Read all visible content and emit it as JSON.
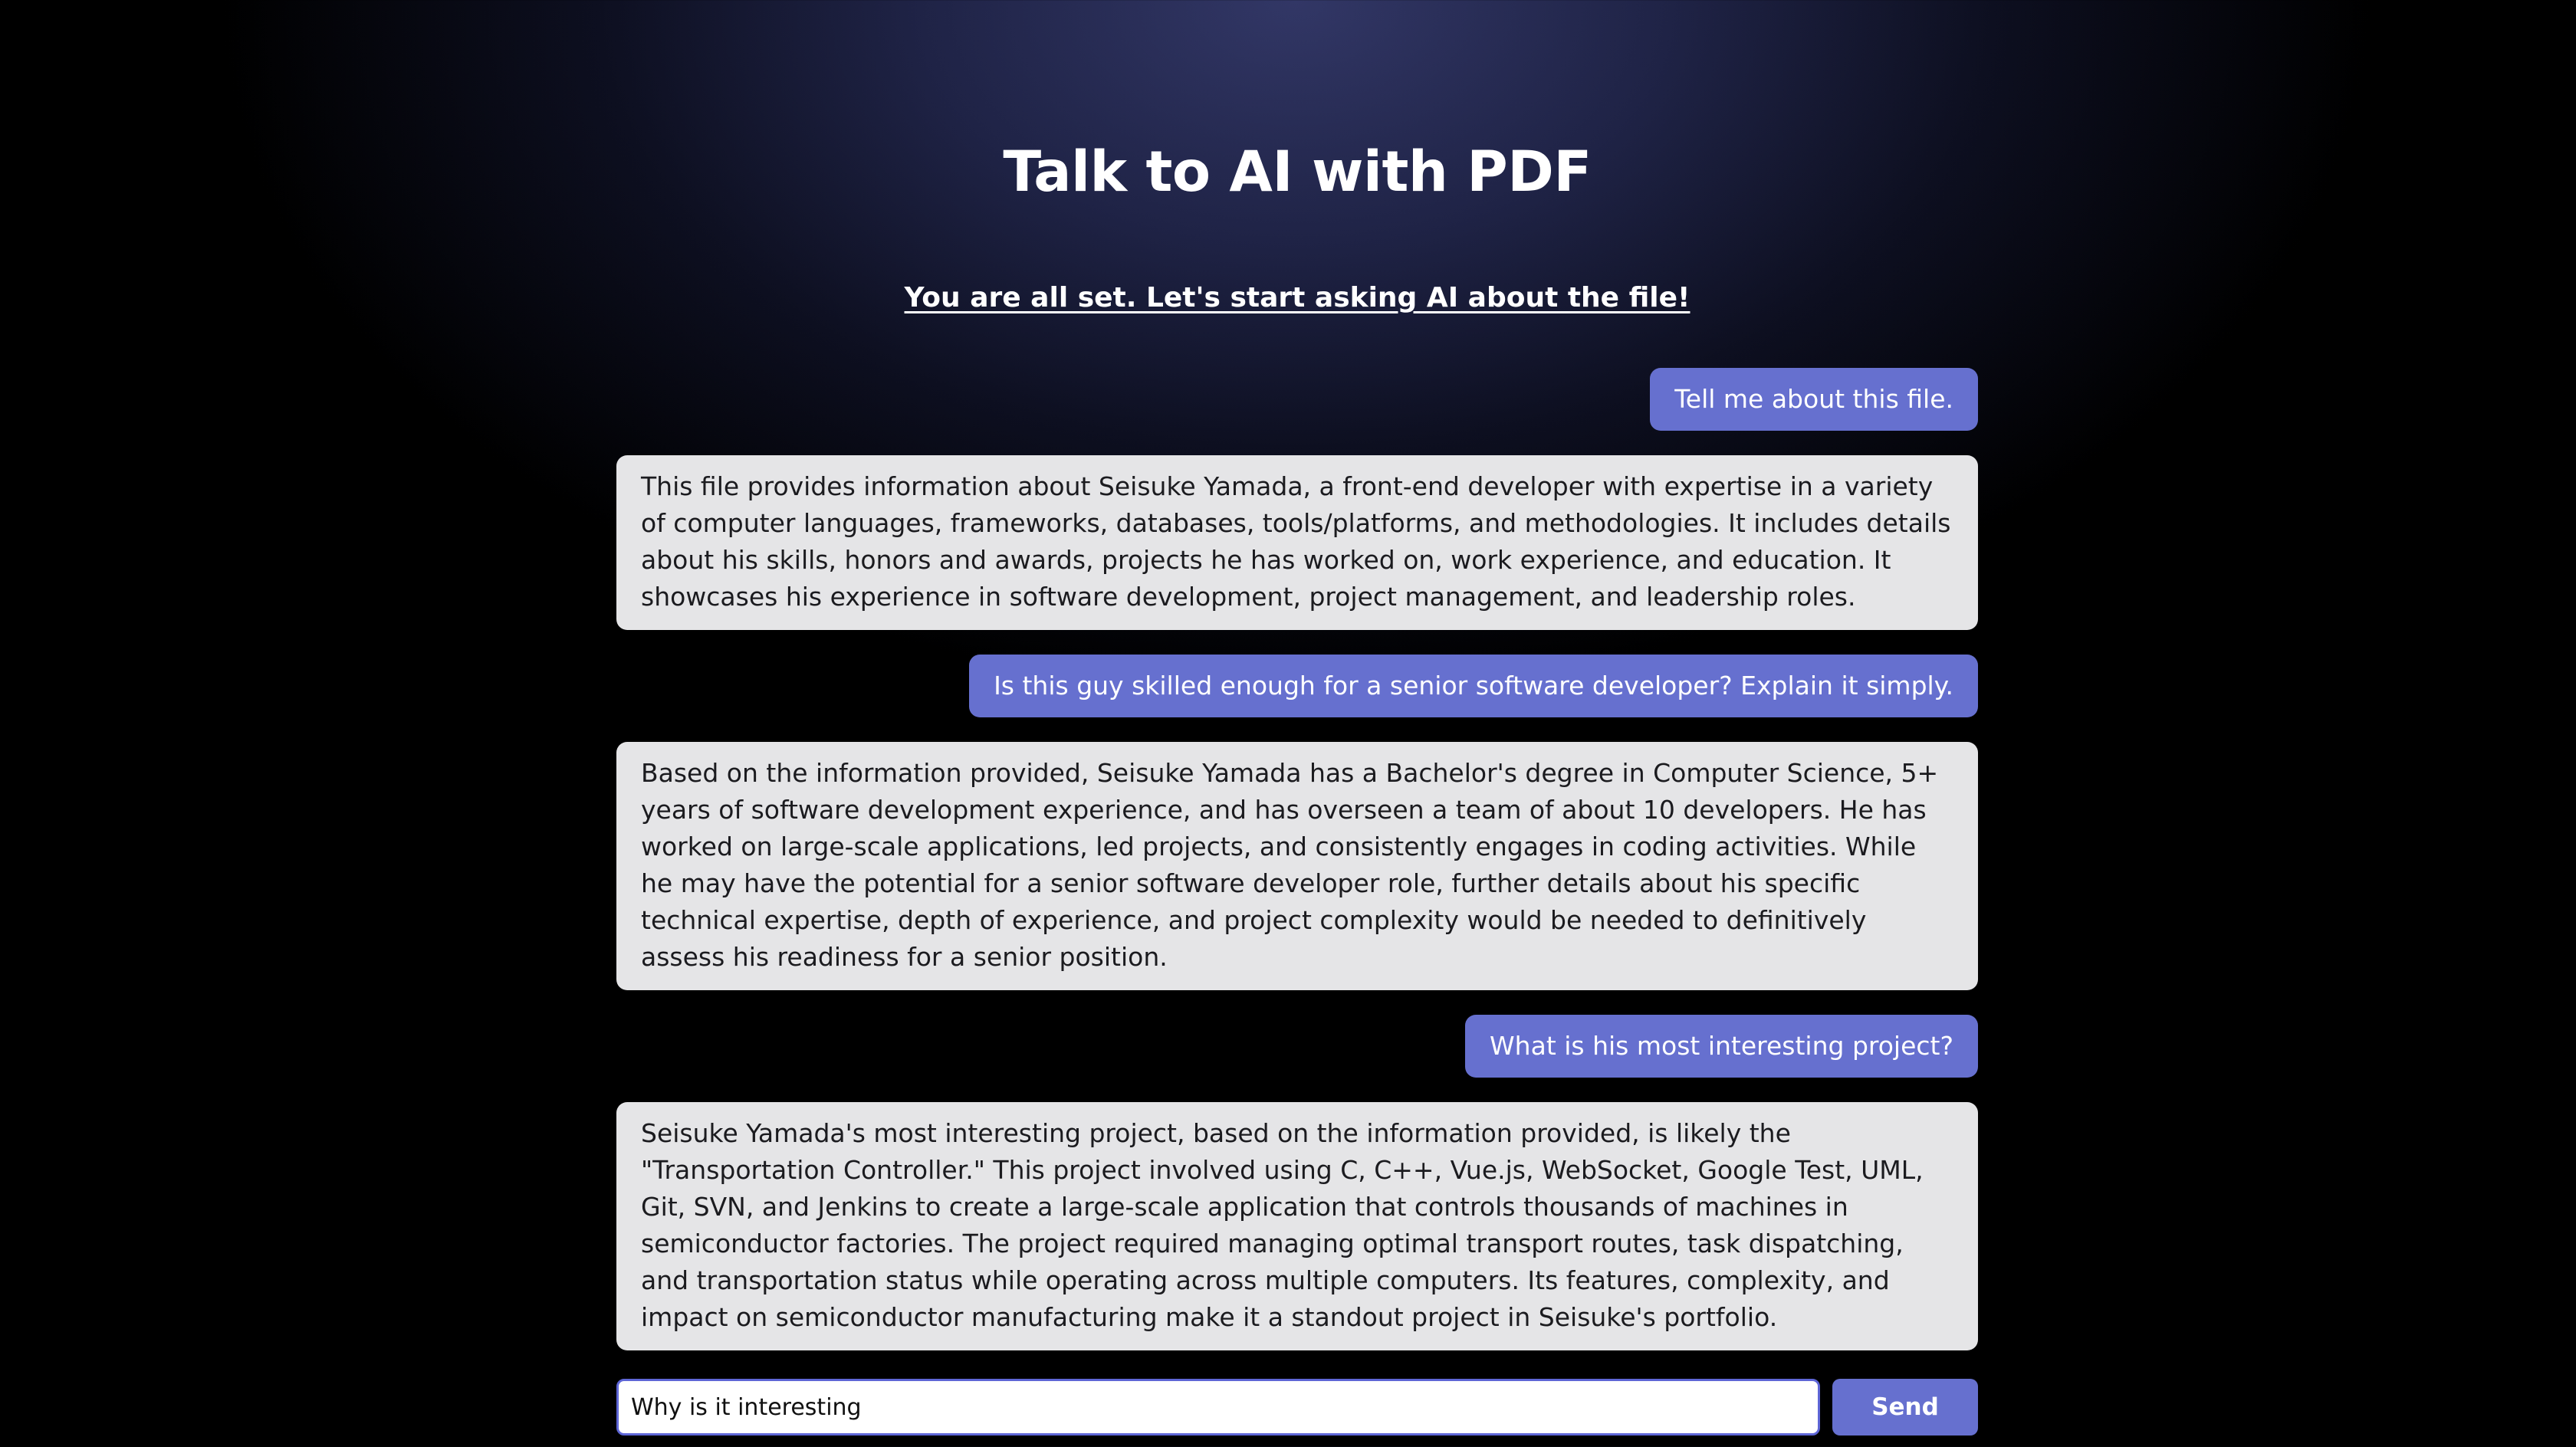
{
  "header": {
    "title": "Talk to AI with PDF",
    "status": "You are all set. Let's start asking AI about the file!"
  },
  "chat": {
    "messages": [
      {
        "role": "user",
        "text": "Tell me about this file."
      },
      {
        "role": "ai",
        "text": "This file provides information about Seisuke Yamada, a front-end developer with expertise in a variety of computer languages, frameworks, databases, tools/platforms, and methodologies. It includes details about his skills, honors and awards, projects he has worked on, work experience, and education. It showcases his experience in software development, project management, and leadership roles."
      },
      {
        "role": "user",
        "text": "Is this guy skilled enough for a senior software developer? Explain it simply."
      },
      {
        "role": "ai",
        "text": "Based on the information provided, Seisuke Yamada has a Bachelor's degree in Computer Science, 5+ years of software development experience, and has overseen a team of about 10 developers. He has worked on large-scale applications, led projects, and consistently engages in coding activities. While he may have the potential for a senior software developer role, further details about his specific technical expertise, depth of experience, and project complexity would be needed to definitively assess his readiness for a senior position."
      },
      {
        "role": "user",
        "text": "What is his most interesting project?"
      },
      {
        "role": "ai",
        "text": "Seisuke Yamada's most interesting project, based on the information provided, is likely the \"Transportation Controller.\" This project involved using C, C++, Vue.js, WebSocket, Google Test, UML, Git, SVN, and Jenkins to create a large-scale application that controls thousands of machines in semiconductor factories. The project required managing optimal transport routes, task dispatching, and transportation status while operating across multiple computers. Its features, complexity, and impact on semiconductor manufacturing make it a standout project in Seisuke's portfolio."
      }
    ]
  },
  "composer": {
    "input_value": "Why is it interesting",
    "send_label": "Send"
  },
  "colors": {
    "accent": "#6670cf",
    "ai_bubble": "#e5e5e7",
    "input_border": "#5e66d6"
  }
}
